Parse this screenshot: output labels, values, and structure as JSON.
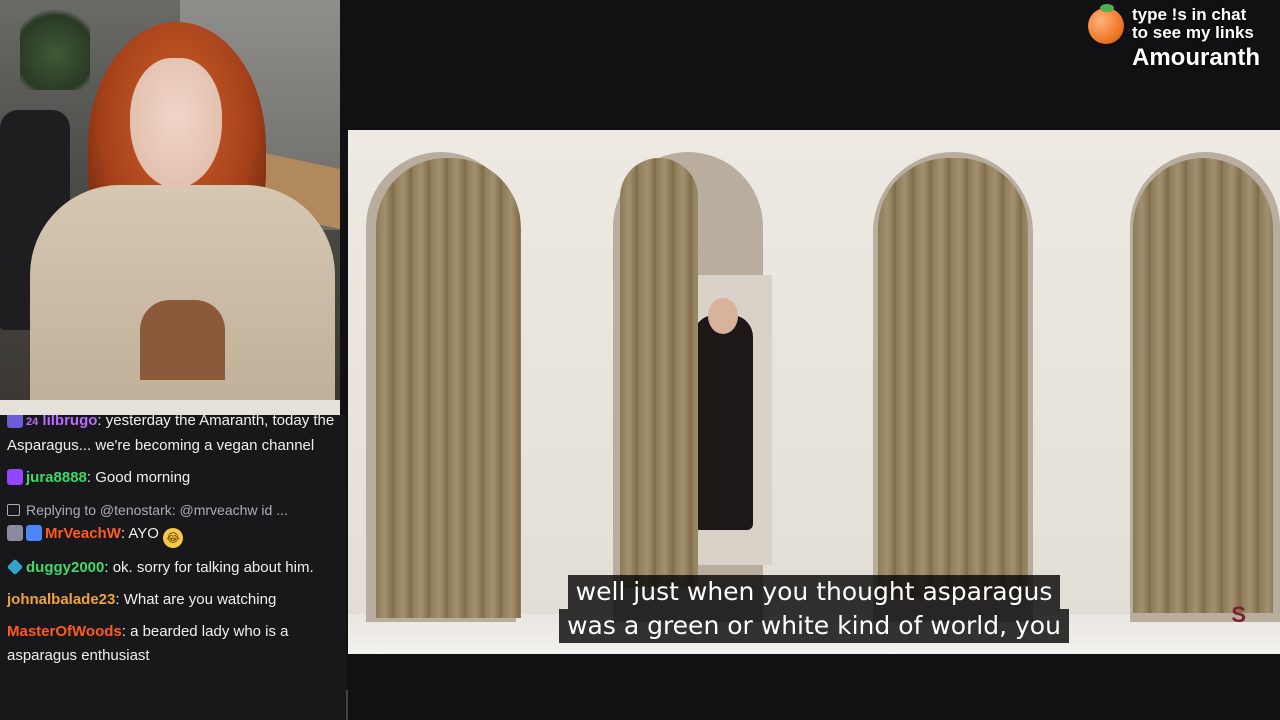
{
  "overlay": {
    "cta_line1": "type !s in chat",
    "cta_line2": "to see my links",
    "streamer_name": "Amouranth"
  },
  "chat": {
    "messages": [
      {
        "badge_count": "24",
        "user": "lilbrugo",
        "text": ": yesterday the Amaranth, today the Asparagus... we're becoming a vegan channel",
        "user_color": "#b86cff"
      },
      {
        "user": "jura8888",
        "text": ": Good morning",
        "user_color": "#3fd96a"
      },
      {
        "reply": "Replying to @tenostark: @mrveachw id ...",
        "user": "MrVeachW",
        "text": ": AYO",
        "emote": "😂",
        "user_color": "#ff5a1f"
      },
      {
        "user": "duggy2000",
        "text": ": ok. sorry for talking about him.",
        "user_color": "#3fd96a"
      },
      {
        "user": "johnalbalade23",
        "text": ": What are you watching",
        "user_color": "#f0a23a"
      },
      {
        "user": "MasterOfWoods",
        "text": ": a bearded lady who is a asparagus enthusiast",
        "user_color": "#ff5a1f"
      }
    ]
  },
  "video": {
    "subtitle_line1": "well just when you thought asparagus",
    "subtitle_line2": "was a green or white kind of world, you",
    "watermark": "S"
  }
}
